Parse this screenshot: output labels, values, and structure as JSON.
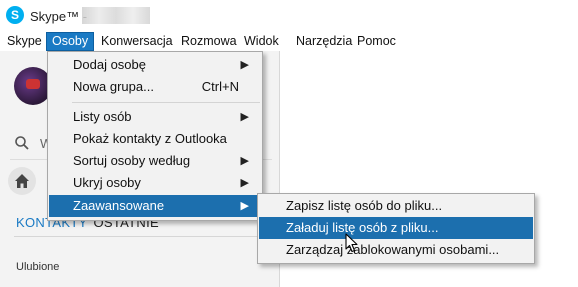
{
  "window": {
    "title": "Skype™ -",
    "app_icon_letter": "S"
  },
  "menubar": {
    "items": [
      {
        "label": "Skype",
        "active": false
      },
      {
        "label": "Osoby",
        "active": true
      },
      {
        "label": "Konwersacja",
        "active": false
      },
      {
        "label": "Rozmowa",
        "active": false
      },
      {
        "label": "Widok",
        "active": false
      },
      {
        "label": "Narzędzia",
        "active": false
      },
      {
        "label": "Pomoc",
        "active": false
      }
    ]
  },
  "sidebar": {
    "search_text": "W",
    "tabs": {
      "contacts": "KONTAKTY",
      "recent": "OSTATNIE"
    },
    "favorites_label": "Ulubione"
  },
  "osoby_menu": {
    "items": [
      {
        "label": "Dodaj osobę",
        "has_submenu": true,
        "shortcut": ""
      },
      {
        "label": "Nowa grupa...",
        "has_submenu": false,
        "shortcut": "Ctrl+N"
      },
      {
        "label": "Listy osób",
        "has_submenu": true,
        "shortcut": ""
      },
      {
        "label": "Pokaż kontakty z Outlooka",
        "has_submenu": false,
        "shortcut": ""
      },
      {
        "label": "Sortuj osoby według",
        "has_submenu": true,
        "shortcut": ""
      },
      {
        "label": "Ukryj osoby",
        "has_submenu": true,
        "shortcut": ""
      },
      {
        "label": "Zaawansowane",
        "has_submenu": true,
        "shortcut": "",
        "highlighted": true
      }
    ]
  },
  "advanced_submenu": {
    "items": [
      {
        "label": "Zapisz listę osób do pliku...",
        "selected": false
      },
      {
        "label": "Załaduj listę osób z pliku...",
        "selected": true
      },
      {
        "label": "Zarządzaj zablokowanymi osobami...",
        "selected": false
      }
    ]
  },
  "colors": {
    "accent": "#1a7ac4",
    "skype_blue": "#00aff0",
    "menu_bg": "#f2f2f2",
    "highlight": "#1c6fae"
  },
  "icons": {
    "app": "skype-logo-icon",
    "search": "search-icon",
    "home": "home-icon",
    "submenu_arrow": "chevron-right-icon",
    "cursor": "mouse-pointer-icon"
  }
}
